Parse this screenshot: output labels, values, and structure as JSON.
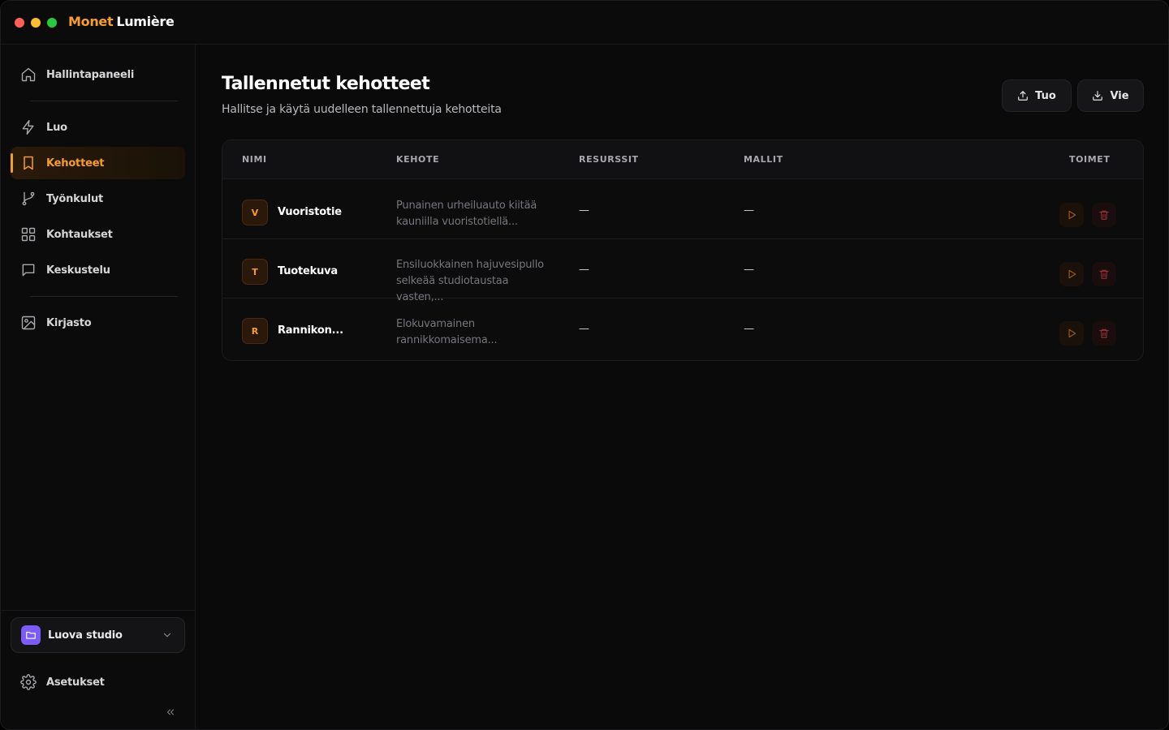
{
  "app": {
    "brand_part1": "Monet",
    "brand_part2": "Lumière",
    "accent_color": "#f59e2b"
  },
  "sidebar": {
    "items": [
      {
        "label": "Hallintapaneeli",
        "icon": "home-icon"
      },
      {
        "label": "Luo",
        "icon": "lightning-icon"
      },
      {
        "label": "Kehotteet",
        "icon": "bookmark-icon",
        "active": true
      },
      {
        "label": "Työnkulut",
        "icon": "git-branch-icon"
      },
      {
        "label": "Kohtaukset",
        "icon": "grid-icon"
      },
      {
        "label": "Keskustelu",
        "icon": "chat-icon"
      },
      {
        "label": "Kirjasto",
        "icon": "image-icon"
      }
    ],
    "workspace": {
      "label": "Luova studio",
      "icon": "folder-icon",
      "color": "#7c5cf6"
    },
    "settings": {
      "label": "Asetukset",
      "icon": "gear-icon"
    },
    "collapse_icon": "chevrons-left-icon"
  },
  "page": {
    "title": "Tallennetut kehotteet",
    "subtitle": "Hallitse ja käytä uudelleen tallennettuja kehotteita",
    "import_label": "Tuo",
    "export_label": "Vie"
  },
  "table": {
    "headers": {
      "name": "NIMI",
      "prompt": "KEHOTE",
      "resources": "RESURSSIT",
      "models": "MALLIT",
      "actions": "TOIMET"
    },
    "rows": [
      {
        "initial": "V",
        "name": "Vuoristotie",
        "prompt_line1": "Punainen urheiluauto kiitää",
        "prompt_line2": "kauniilla vuoristotiellä...",
        "resources": "—",
        "models": "—"
      },
      {
        "initial": "T",
        "name": "Tuotekuva",
        "prompt_line1": "Ensiluokkainen hajuvesipullo",
        "prompt_line2": "selkeää studiotaustaa vasten,...",
        "resources": "—",
        "models": "—"
      },
      {
        "initial": "R",
        "name": "Rannikon...",
        "prompt_line1": "Elokuvamainen",
        "prompt_line2": "rannikkomaisema...",
        "resources": "—",
        "models": "—"
      }
    ]
  }
}
